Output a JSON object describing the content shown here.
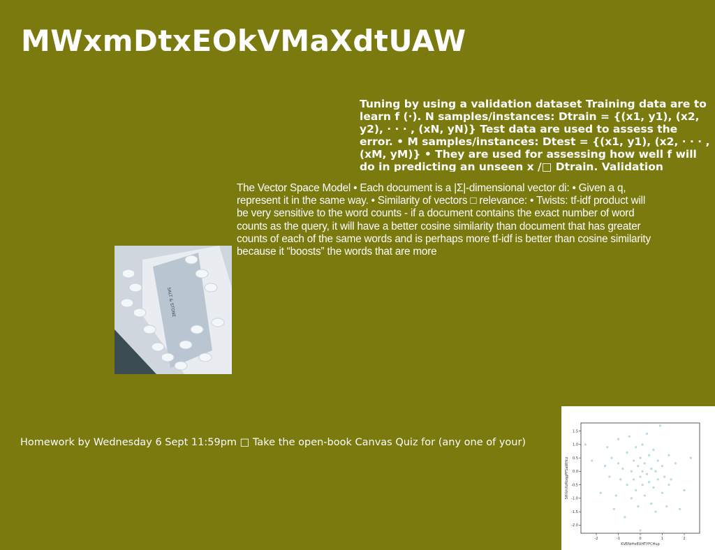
{
  "slide": {
    "title": "MWxmDtxEOkVMaXdtUAW",
    "validation_text": "Tuning by using a validation dataset Training data are to learn f (·). N samples/instances: Dtrain = {(x1, y1), (x2, y2), · · · , (xN, yN)} Test data are used to assess the error. • M samples/instances: Dtest = {(x1, y1), (x2, · · · , (xM, yM)} • They are used for assessing how well f will do in predicting an unseen x /□ Dtrain. Validation",
    "vsm_text": "The Vector Space Model • Each document is a |Σ|-dimensional vector di: • Given a q, represent it in the same way. • Similarity of vectors □ relevance: • Twists:  tf-idf product will be very sensitive to the word counts - if a document contains the exact number of word counts as the query, it will have a better cosine similarity than document that has greater counts of each of the same words and is perhaps more tf-idf is better than cosine similarity because it “boosts” the words that are more",
    "homework_text": "Homework by Wednesday 6 Sept 11:59pm □ Take the open-book Canvas Quiz for (any one of your)"
  },
  "chart_data": {
    "type": "scatter",
    "xlabel": "KVENrHxEUHTYFCHup",
    "ylabel": "SHrVnXzRbqgPFSaWHcz",
    "xlim": [
      -2.7,
      2.7
    ],
    "ylim": [
      -2.3,
      1.8
    ],
    "xticks": [
      "-2",
      "-1",
      "0",
      "1",
      "2"
    ],
    "yticks": [
      "-2.0",
      "-1.5",
      "-1.0",
      "-0.5",
      "0.0",
      "0.5",
      "1.0",
      "1.5"
    ],
    "color": "#a8d8cf",
    "points": [
      [
        -2.5,
        1.0
      ],
      [
        -2.2,
        0.4
      ],
      [
        -1.8,
        -0.8
      ],
      [
        -1.6,
        0.2
      ],
      [
        -1.5,
        0.9
      ],
      [
        -1.4,
        -0.2
      ],
      [
        -1.3,
        0.5
      ],
      [
        -1.2,
        -1.4
      ],
      [
        -1.1,
        -0.9
      ],
      [
        -1.0,
        0.3
      ],
      [
        -1.0,
        1.2
      ],
      [
        -0.9,
        -0.3
      ],
      [
        -0.8,
        0.1
      ],
      [
        -0.7,
        -1.7
      ],
      [
        -0.6,
        0.7
      ],
      [
        -0.6,
        -0.5
      ],
      [
        -0.5,
        1.3
      ],
      [
        -0.4,
        0.0
      ],
      [
        -0.4,
        -1.0
      ],
      [
        -0.3,
        0.4
      ],
      [
        -0.3,
        -0.3
      ],
      [
        -0.2,
        0.9
      ],
      [
        -0.2,
        -0.7
      ],
      [
        -0.1,
        0.2
      ],
      [
        -0.1,
        -1.3
      ],
      [
        0.0,
        0.5
      ],
      [
        0.0,
        -0.2
      ],
      [
        0.0,
        -2.2
      ],
      [
        0.1,
        1.0
      ],
      [
        0.1,
        -0.5
      ],
      [
        0.1,
        0.0
      ],
      [
        0.2,
        0.3
      ],
      [
        0.2,
        -0.9
      ],
      [
        0.3,
        -0.1
      ],
      [
        0.3,
        1.4
      ],
      [
        0.4,
        -0.4
      ],
      [
        0.4,
        0.6
      ],
      [
        0.5,
        -1.2
      ],
      [
        0.5,
        0.1
      ],
      [
        0.6,
        -0.6
      ],
      [
        0.6,
        0.8
      ],
      [
        0.7,
        0.0
      ],
      [
        0.7,
        -1.5
      ],
      [
        0.8,
        0.4
      ],
      [
        0.8,
        -0.3
      ],
      [
        0.9,
        1.7
      ],
      [
        1.0,
        -0.8
      ],
      [
        1.0,
        0.2
      ],
      [
        1.1,
        -0.2
      ],
      [
        1.2,
        -1.3
      ],
      [
        1.3,
        0.6
      ],
      [
        1.3,
        -0.5
      ],
      [
        1.4,
        -0.3
      ],
      [
        1.6,
        0.3
      ],
      [
        1.8,
        -1.4
      ],
      [
        2.0,
        -0.7
      ],
      [
        2.3,
        0.5
      ]
    ]
  },
  "photo": {
    "label": "SALT & STONE",
    "colors": [
      "#d7dde3",
      "#3b4b52",
      "#eef2f5"
    ]
  }
}
